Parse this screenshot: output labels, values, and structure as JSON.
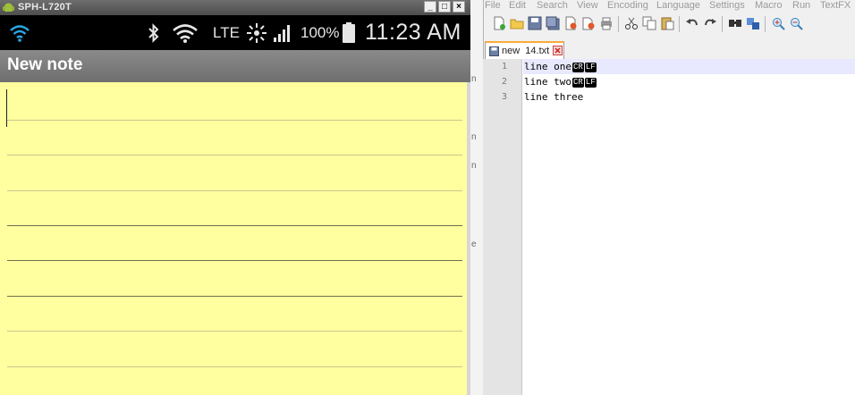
{
  "emulator": {
    "window_title": "SPH-L720T",
    "window_buttons": {
      "minimize": "_",
      "maximize": "□",
      "close": "×"
    },
    "status_bar": {
      "network": "LTE",
      "battery": "100%",
      "time": "11:23 AM",
      "icons": [
        "wifi-icon",
        "bluetooth-icon",
        "wifi-calling-icon",
        "network-activity-icon",
        "signal-icon",
        "battery-icon"
      ]
    },
    "action_bar": {
      "title": "New note"
    },
    "note": {
      "text": ""
    }
  },
  "notepad": {
    "left_strip_chars": [
      "n",
      "n",
      "n",
      "e"
    ],
    "menu": [
      "File",
      "Edit",
      "Search",
      "View",
      "Encoding",
      "Language",
      "Settings",
      "Macro",
      "Run",
      "TextFX"
    ],
    "toolbar": [
      "new-file-icon",
      "open-file-icon",
      "save-icon",
      "save-all-icon",
      "close-icon",
      "close-all-icon",
      "print-icon",
      "cut-icon",
      "copy-icon",
      "paste-icon",
      "undo-icon",
      "redo-icon",
      "find-icon",
      "replace-icon",
      "zoom-in-icon",
      "zoom-out-icon"
    ],
    "tabs": [
      {
        "label": "new  14.txt",
        "active": true
      }
    ],
    "editor": {
      "lines": [
        {
          "number": "1",
          "text": "line one",
          "eol": [
            "CR",
            "LF"
          ]
        },
        {
          "number": "2",
          "text": "line two",
          "eol": [
            "CR",
            "LF"
          ]
        },
        {
          "number": "3",
          "text": "line three",
          "eol": []
        }
      ],
      "current_line": 1
    }
  },
  "colors": {
    "note_background": "#ffff9f",
    "tab_accent": "#f9ab3a",
    "current_line": "#e8e8ff"
  }
}
